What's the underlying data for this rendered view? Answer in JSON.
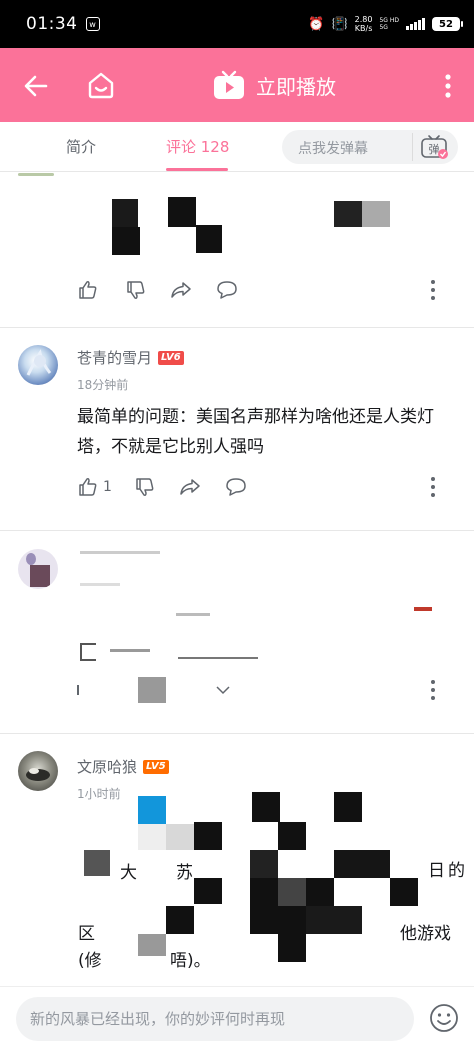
{
  "status_bar": {
    "time": "01:34",
    "net_speed_value": "2.80",
    "net_speed_unit": "KB/s",
    "signal_label_top": "5G HD",
    "signal_label_bottom": "5G",
    "battery": "52"
  },
  "header": {
    "play_now_label": "立即播放",
    "accent_color": "#fb7299"
  },
  "tabs": [
    {
      "label": "简介"
    },
    {
      "label": "评论 128"
    }
  ],
  "danmaku": {
    "placeholder": "点我发弹幕",
    "button_label": "弹"
  },
  "comments": [
    {
      "like_count": ""
    },
    {
      "username": "苍青的雪月",
      "level": "LV6",
      "time": "18分钟前",
      "text": "最简单的问题：美国名声那样为啥他还是人类灯塔，不就是它比别人强吗",
      "like_count": "1"
    },
    {
      "like_count": ""
    },
    {
      "username": "文原哈狼",
      "level": "LV5",
      "time": "1小时前",
      "text_fragments": [
        "大",
        "苏",
        "日",
        "的",
        "区",
        "他游戏",
        "(修",
        "唔)。"
      ]
    }
  ],
  "bottom": {
    "reply_placeholder": "新的风暴已经出现，你的妙评何时再现"
  }
}
